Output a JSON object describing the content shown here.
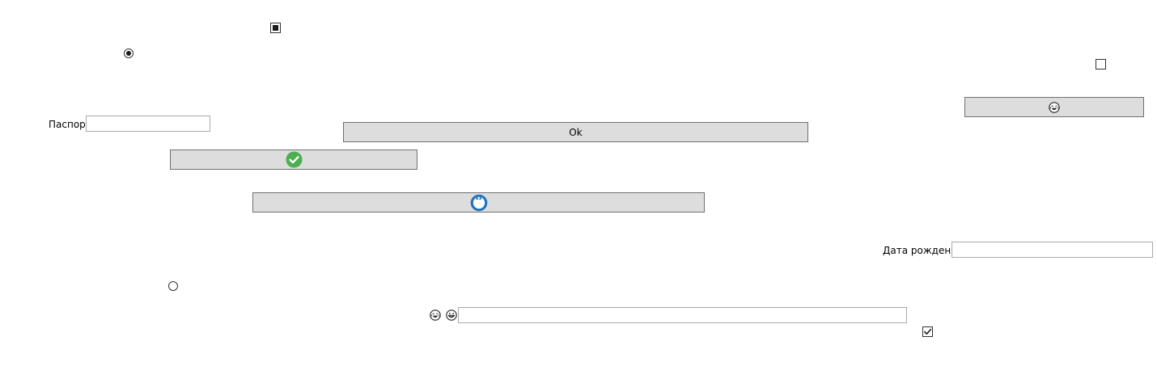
{
  "form": {
    "passport_label": "Паспорт",
    "passport_value": "",
    "birthdate_label": "Дата рождения",
    "birthdate_value": "",
    "bottom_field_value": "",
    "ok_button_label": "Ok",
    "checkbox_top_state": "indeterminate",
    "checkbox_right_checked": false,
    "checkbox_bottom_checked": true,
    "radio_top_selected": true,
    "radio_bottom_selected": false
  },
  "icons": {
    "button_top_right_icon": "laughing-emoji-icon",
    "button_check_icon": "green-check-icon",
    "button_circle_icon": "blue-circle-icon",
    "label_emoji_1": "laughing-emoji-icon",
    "label_emoji_2": "grinning-emoji-icon"
  },
  "colors": {
    "button_bg": "#dddddd",
    "button_border": "#707070",
    "field_border": "#a9a9a9",
    "check_green": "#4caf50",
    "circle_blue": "#1e73be"
  }
}
